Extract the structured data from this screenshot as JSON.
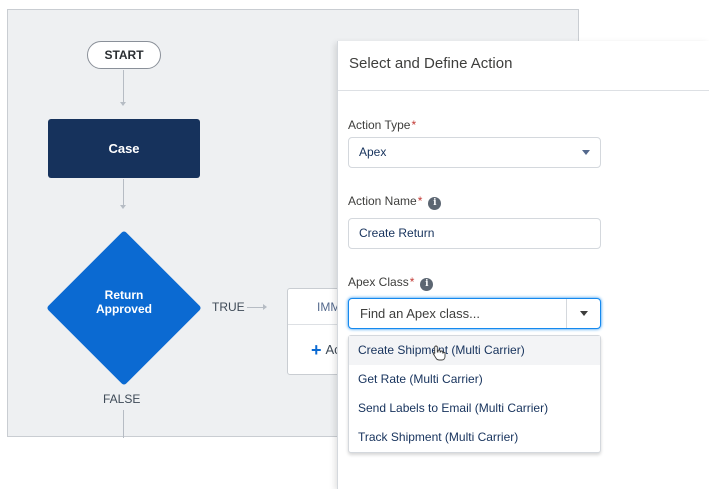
{
  "flow": {
    "start_label": "START",
    "case_label": "Case",
    "decision_label_line1": "Return",
    "decision_label_line2": "Approved",
    "true_label": "TRUE",
    "false_label": "FALSE",
    "immediate_actions_label": "IMM",
    "add_action_label": "Ac"
  },
  "panel": {
    "title": "Select and Define Action",
    "action_type": {
      "label": "Action Type",
      "value": "Apex"
    },
    "action_name": {
      "label": "Action Name",
      "value": "Create Return"
    },
    "apex_class": {
      "label": "Apex Class",
      "placeholder": "Find an Apex class...",
      "options": [
        "Create Shipment (Multi Carrier)",
        "Get Rate (Multi Carrier)",
        "Send Labels to Email (Multi Carrier)",
        "Track Shipment (Multi Carrier)"
      ]
    }
  },
  "colors": {
    "case_node": "#16325c",
    "decision_node": "#0b6ad2",
    "focus_border": "#1589ee",
    "required_asterisk": "#c23934"
  },
  "icons": [
    "info-icon",
    "caret-down-icon",
    "plus-icon",
    "arrow-right-icon",
    "arrow-down-icon",
    "hand-cursor-icon"
  ]
}
